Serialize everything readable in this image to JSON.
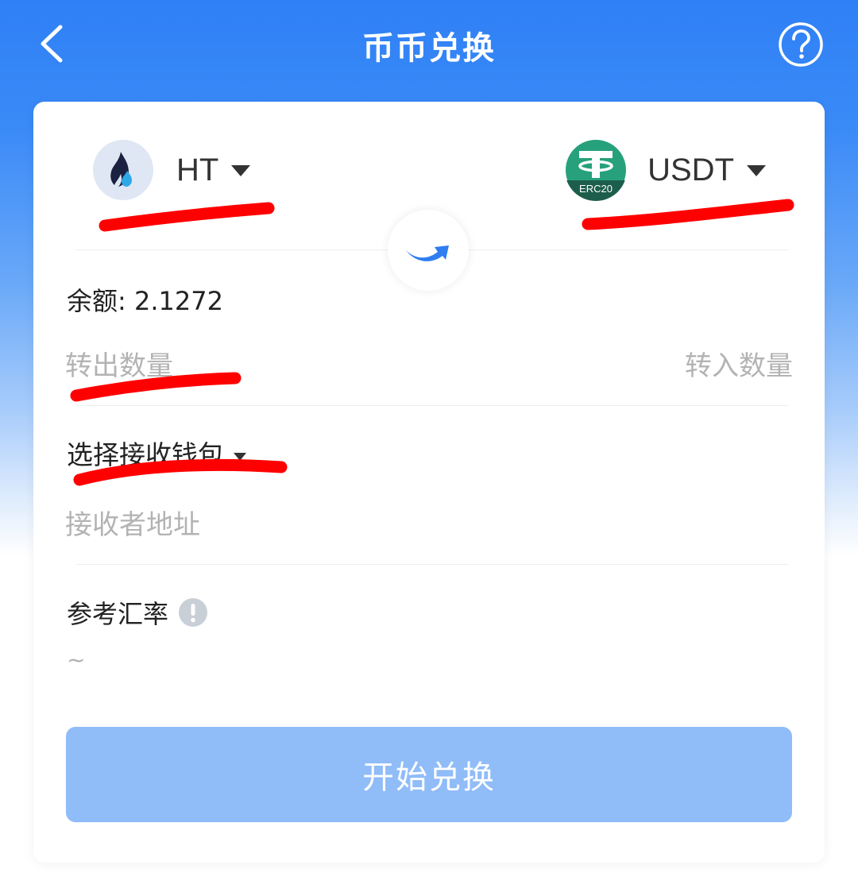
{
  "header": {
    "title": "币币兑换"
  },
  "swap": {
    "from": {
      "symbol": "HT"
    },
    "to": {
      "symbol": "USDT",
      "badge": "ERC20"
    },
    "balance_label": "余额: 2.1272",
    "amount_out_placeholder": "转出数量",
    "amount_out_value": "",
    "amount_in_placeholder": "转入数量",
    "amount_in_value": ""
  },
  "wallet": {
    "select_label": "选择接收钱包",
    "address_placeholder": "接收者地址",
    "address_value": ""
  },
  "rate": {
    "label": "参考汇率",
    "value": "~"
  },
  "actions": {
    "submit_label": "开始兑换"
  },
  "colors": {
    "header_blue": "#2f80f6",
    "button_disabled": "#90bcf8",
    "tether_green": "#26a17b",
    "annotation_red": "#ff0000"
  },
  "icons": [
    "back-arrow-icon",
    "help-icon",
    "ht-logo-icon",
    "usdt-logo-icon",
    "swap-arrow-icon",
    "caret-down-icon",
    "info-icon"
  ]
}
